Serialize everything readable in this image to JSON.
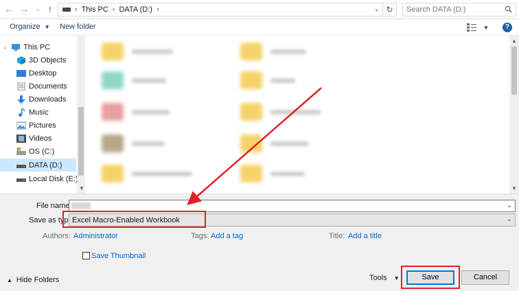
{
  "address_bar": {
    "breadcrumbs": [
      "This PC",
      "DATA (D:)"
    ],
    "search_placeholder": "Search DATA (D:)"
  },
  "toolbar": {
    "organize_label": "Organize",
    "new_folder_label": "New folder"
  },
  "sidebar": {
    "items": [
      {
        "label": "This PC",
        "icon": "this-pc-icon"
      },
      {
        "label": "3D Objects",
        "icon": "3d-objects-icon"
      },
      {
        "label": "Desktop",
        "icon": "desktop-icon"
      },
      {
        "label": "Documents",
        "icon": "documents-icon"
      },
      {
        "label": "Downloads",
        "icon": "downloads-icon"
      },
      {
        "label": "Music",
        "icon": "music-icon"
      },
      {
        "label": "Pictures",
        "icon": "pictures-icon"
      },
      {
        "label": "Videos",
        "icon": "videos-icon"
      },
      {
        "label": "OS (C:)",
        "icon": "drive-icon"
      },
      {
        "label": "DATA (D:)",
        "icon": "drive-icon",
        "selected": true
      },
      {
        "label": "Local Disk (E:)",
        "icon": "drive-icon"
      }
    ]
  },
  "form": {
    "file_name_label": "File name:",
    "save_as_type_label": "Save as type:",
    "save_as_type_value": "Excel Macro-Enabled Workbook",
    "authors_label": "Authors:",
    "authors_value": "Administrator",
    "tags_label": "Tags:",
    "tags_value": "Add a tag",
    "title_label": "Title:",
    "title_value": "Add a title",
    "save_thumbnail_label": "Save Thumbnail"
  },
  "footer": {
    "hide_folders_label": "Hide Folders",
    "tools_label": "Tools",
    "save_label": "Save",
    "cancel_label": "Cancel"
  },
  "colors": {
    "highlight": "#e0202a",
    "link": "#0066cc",
    "selection": "#cce8ff"
  }
}
